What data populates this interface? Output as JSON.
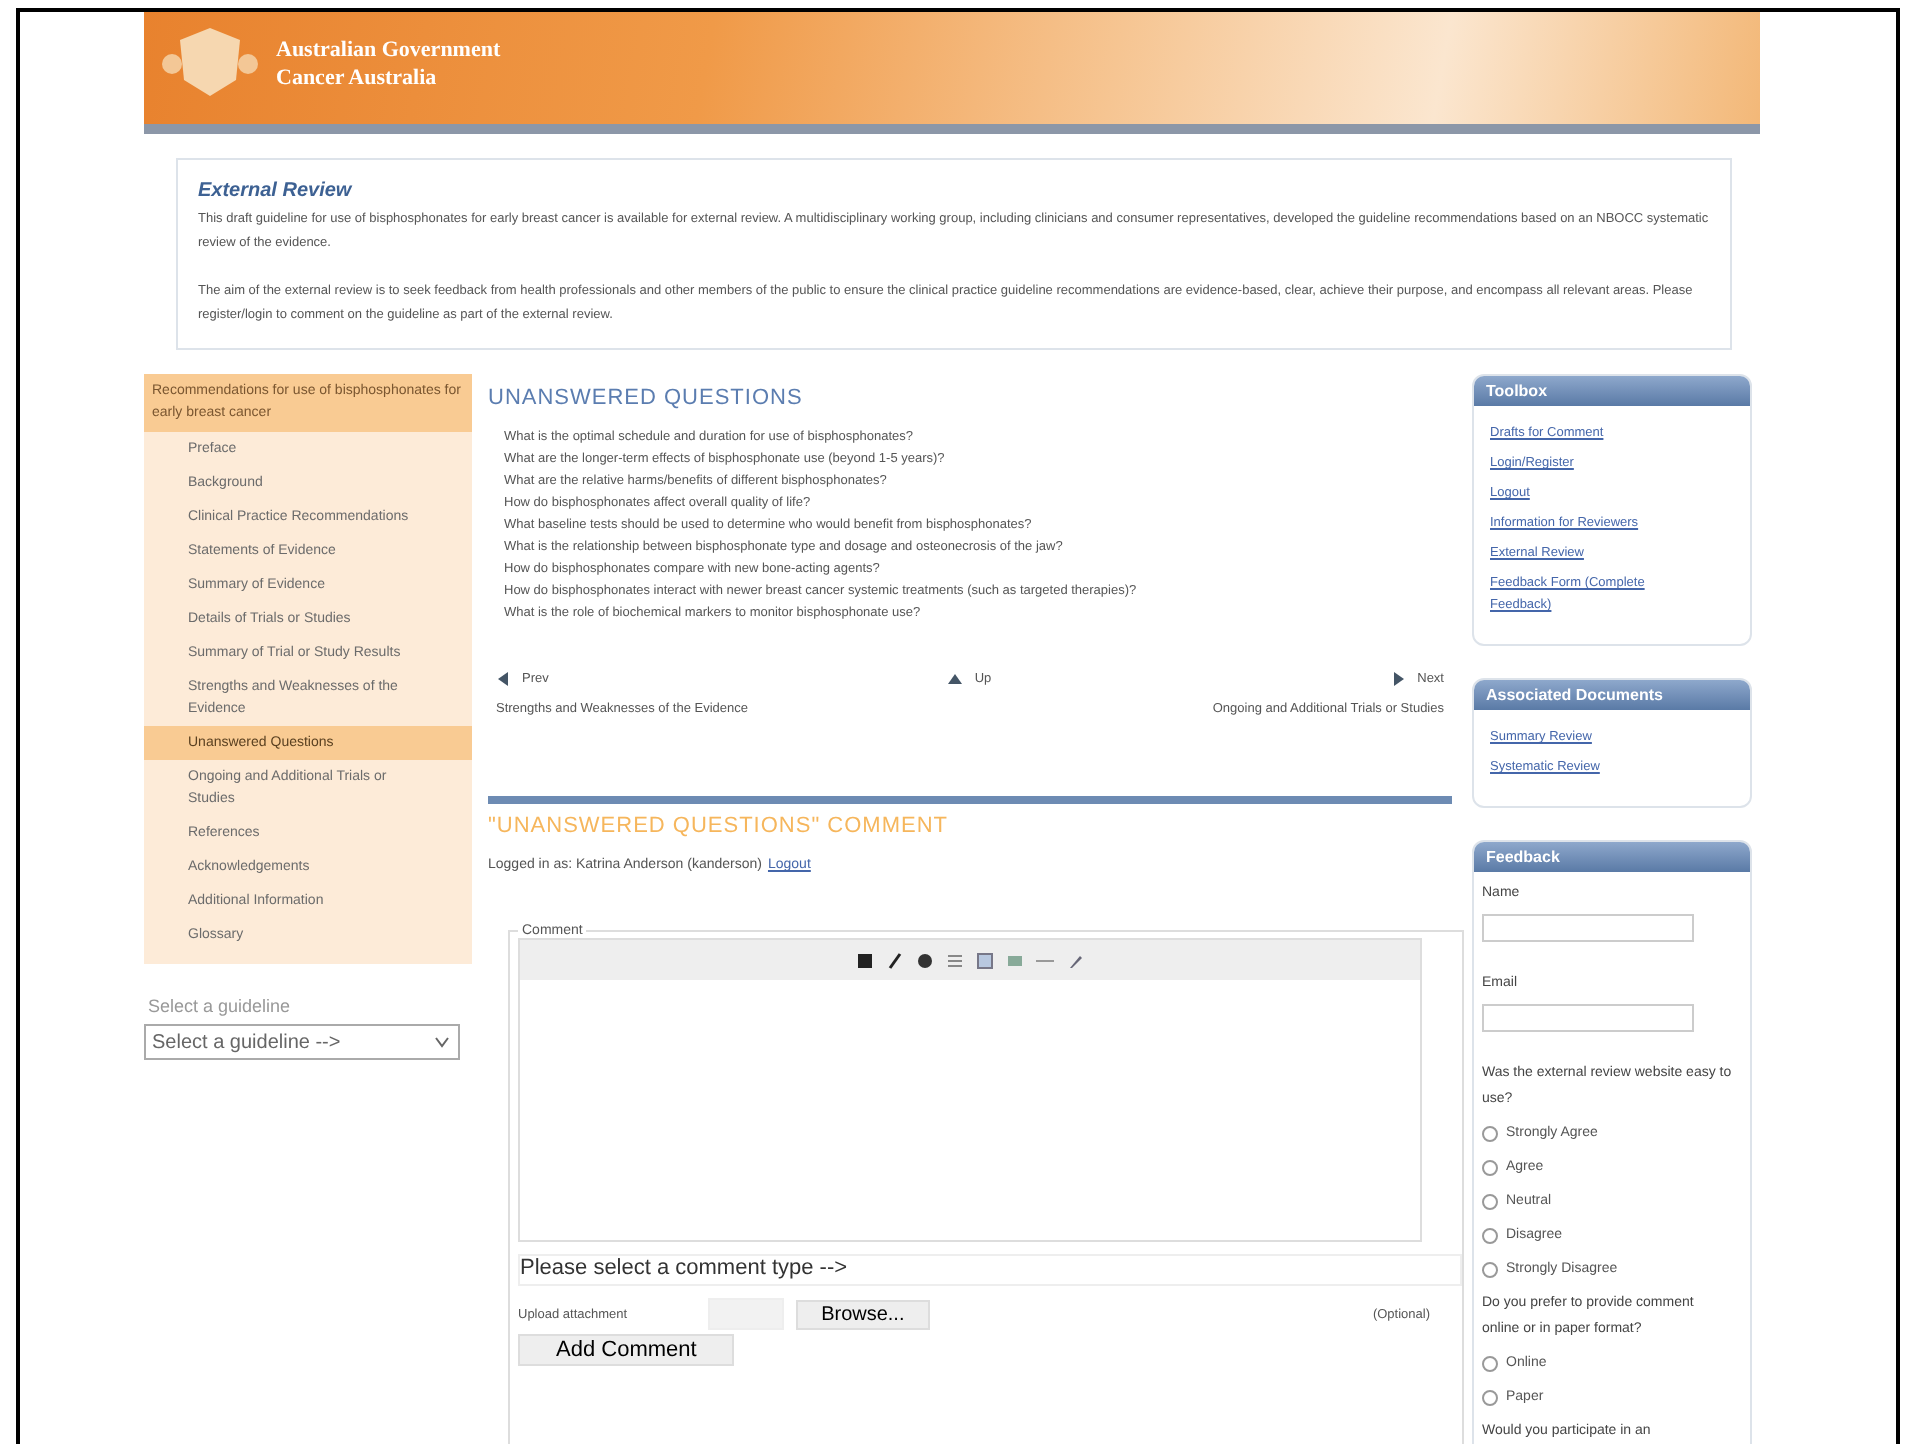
{
  "header": {
    "title": "Australian Government",
    "subtitle": "Cancer Australia"
  },
  "intro": {
    "title": "External Review",
    "paragraphs": [
      "This draft guideline for use of bisphosphonates for early breast cancer is available for external review. A multidisciplinary working group, including clinicians and consumer representatives, developed the guideline recommendations based on an NBOCC systematic review of the evidence.",
      "The aim of the external review is to seek feedback from health professionals and other members of the public to ensure the clinical practice guideline recommendations are evidence-based, clear, achieve their purpose, and encompass all relevant areas. Please register/login to comment on the guideline as part of the external review."
    ]
  },
  "sidebar": {
    "title": "Recommendations for use of bisphosphonates for early breast cancer",
    "items": [
      {
        "label": "Preface",
        "selected": false
      },
      {
        "label": "Background",
        "selected": false
      },
      {
        "label": "Clinical Practice Recommendations",
        "selected": false
      },
      {
        "label": "Statements of Evidence",
        "selected": false
      },
      {
        "label": "Summary of Evidence",
        "selected": false
      },
      {
        "label": "Details of Trials or Studies",
        "selected": false
      },
      {
        "label": "Summary of Trial or Study Results",
        "selected": false
      },
      {
        "label": "Strengths and Weaknesses of the Evidence",
        "selected": false
      },
      {
        "label": "Unanswered Questions",
        "selected": true
      },
      {
        "label": "Ongoing and Additional Trials or Studies",
        "selected": false
      },
      {
        "label": "References",
        "selected": false
      },
      {
        "label": "Acknowledgements",
        "selected": false
      },
      {
        "label": "Additional Information",
        "selected": false
      },
      {
        "label": "Glossary",
        "selected": false
      }
    ],
    "guideline_label": "Select a guideline",
    "guideline_select": "Select a guideline -->"
  },
  "main": {
    "title": "UNANSWERED QUESTIONS",
    "questions": [
      "What is the optimal schedule and duration for use of bisphosphonates?",
      "What are the longer-term effects of bisphosphonate use (beyond 1-5 years)?",
      "What are the relative harms/benefits of different bisphosphonates?",
      "How do bisphosphonates affect overall quality of life?",
      "What baseline tests should be used to determine who would benefit from bisphosphonates?",
      "What is the relationship between bisphosphonate type and dosage and osteonecrosis of the jaw?",
      "How do bisphosphonates compare with new bone-acting agents?",
      "How do bisphosphonates interact with newer breast cancer systemic treatments (such as targeted therapies)?",
      "What is the role of biochemical markers to monitor bisphosphonate use?"
    ],
    "nav": {
      "prev": "Prev",
      "up": "Up",
      "next": "Next",
      "prev_page": "Strengths and Weaknesses of the Evidence",
      "next_page": "Ongoing and Additional Trials or Studies"
    },
    "comment_title": "\"UNANSWERED QUESTIONS\" COMMENT",
    "logged_in": "Logged in as: Katrina Anderson (kanderson)",
    "logout": "Logout",
    "comment_legend": "Comment",
    "comment_type": "Please select a comment type -->",
    "upload_label": "Upload attachment",
    "browse": "Browse...",
    "optional": "(Optional)",
    "submit": "Add Comment"
  },
  "toolbox": {
    "title": "Toolbox",
    "links": [
      "Drafts for Comment",
      "Login/Register",
      "Logout",
      "Information for Reviewers",
      "External Review",
      "Feedback Form (Complete Feedback)"
    ]
  },
  "documents": {
    "title": "Associated Documents",
    "links": [
      "Summary Review",
      "Systematic Review"
    ]
  },
  "feedback": {
    "title": "Feedback",
    "name_label": "Name",
    "email_label": "Email",
    "questions": [
      {
        "text": "Was the external review website easy to use?",
        "options": [
          {
            "label": "Strongly Agree",
            "checked": false
          },
          {
            "label": "Agree",
            "checked": false
          },
          {
            "label": "Neutral",
            "checked": false
          },
          {
            "label": "Disagree",
            "checked": false
          },
          {
            "label": "Strongly Disagree",
            "checked": false
          }
        ]
      },
      {
        "text": "Do you prefer to provide comment online or in paper format?",
        "options": [
          {
            "label": "Online",
            "checked": false
          },
          {
            "label": "Paper",
            "checked": false
          }
        ]
      },
      {
        "text": "Would you participate in an"
      }
    ]
  }
}
